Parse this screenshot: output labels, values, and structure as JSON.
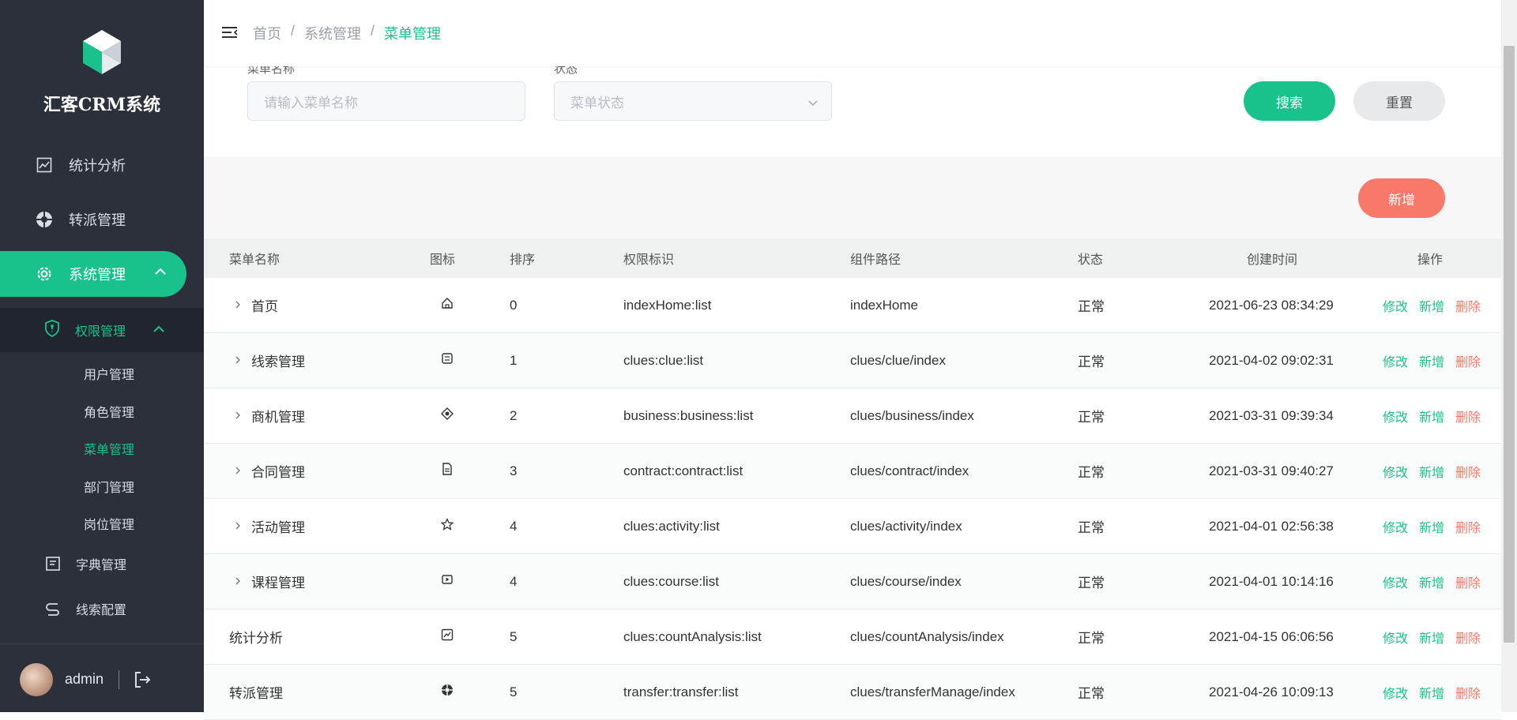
{
  "app": {
    "title": "汇客CRM系统"
  },
  "sidebar": {
    "items": [
      {
        "label": "统计分析"
      },
      {
        "label": "转派管理"
      },
      {
        "label": "系统管理"
      }
    ],
    "submenu": {
      "label": "权限管理",
      "items": [
        {
          "label": "用户管理"
        },
        {
          "label": "角色管理"
        },
        {
          "label": "菜单管理"
        },
        {
          "label": "部门管理"
        },
        {
          "label": "岗位管理"
        }
      ]
    },
    "extra": [
      {
        "label": "字典管理"
      },
      {
        "label": "线索配置"
      }
    ],
    "user": {
      "name": "admin"
    }
  },
  "breadcrumb": {
    "home": "首页",
    "section": "系统管理",
    "current": "菜单管理",
    "sep": "/"
  },
  "search": {
    "name_label": "菜单名称",
    "name_placeholder": "请输入菜单名称",
    "status_label": "状态",
    "status_placeholder": "菜单状态",
    "search_button": "搜索",
    "reset_button": "重置"
  },
  "toolbar": {
    "add_button": "新增"
  },
  "table": {
    "headers": {
      "name": "菜单名称",
      "icon": "图标",
      "sort": "排序",
      "perm": "权限标识",
      "path": "组件路径",
      "status": "状态",
      "time": "创建时间",
      "ops": "操作"
    },
    "ops": {
      "edit": "修改",
      "add": "新增",
      "del": "删除"
    },
    "rows": [
      {
        "name": "首页",
        "expandable": true,
        "icon": "home-icon",
        "sort": "0",
        "perm": "indexHome:list",
        "path": "indexHome",
        "status": "正常",
        "time": "2021-06-23 08:34:29"
      },
      {
        "name": "线索管理",
        "expandable": true,
        "icon": "clue-icon",
        "sort": "1",
        "perm": "clues:clue:list",
        "path": "clues/clue/index",
        "status": "正常",
        "time": "2021-04-02 09:02:31"
      },
      {
        "name": "商机管理",
        "expandable": true,
        "icon": "target-icon",
        "sort": "2",
        "perm": "business:business:list",
        "path": "clues/business/index",
        "status": "正常",
        "time": "2021-03-31 09:39:34"
      },
      {
        "name": "合同管理",
        "expandable": true,
        "icon": "document-icon",
        "sort": "3",
        "perm": "contract:contract:list",
        "path": "clues/contract/index",
        "status": "正常",
        "time": "2021-03-31 09:40:27"
      },
      {
        "name": "活动管理",
        "expandable": true,
        "icon": "star-icon",
        "sort": "4",
        "perm": "clues:activity:list",
        "path": "clues/activity/index",
        "status": "正常",
        "time": "2021-04-01 02:56:38"
      },
      {
        "name": "课程管理",
        "expandable": true,
        "icon": "video-icon",
        "sort": "4",
        "perm": "clues:course:list",
        "path": "clues/course/index",
        "status": "正常",
        "time": "2021-04-01 10:14:16"
      },
      {
        "name": "统计分析",
        "expandable": false,
        "icon": "chart-icon",
        "sort": "5",
        "perm": "clues:countAnalysis:list",
        "path": "clues/countAnalysis/index",
        "status": "正常",
        "time": "2021-04-15 06:06:56"
      },
      {
        "name": "转派管理",
        "expandable": false,
        "icon": "aperture-icon",
        "sort": "5",
        "perm": "transfer:transfer:list",
        "path": "clues/transferManage/index",
        "status": "正常",
        "time": "2021-04-26 10:09:13"
      }
    ]
  },
  "colors": {
    "accent": "#19c28c",
    "danger": "#f8786a",
    "sidebar": "#2b303b"
  }
}
